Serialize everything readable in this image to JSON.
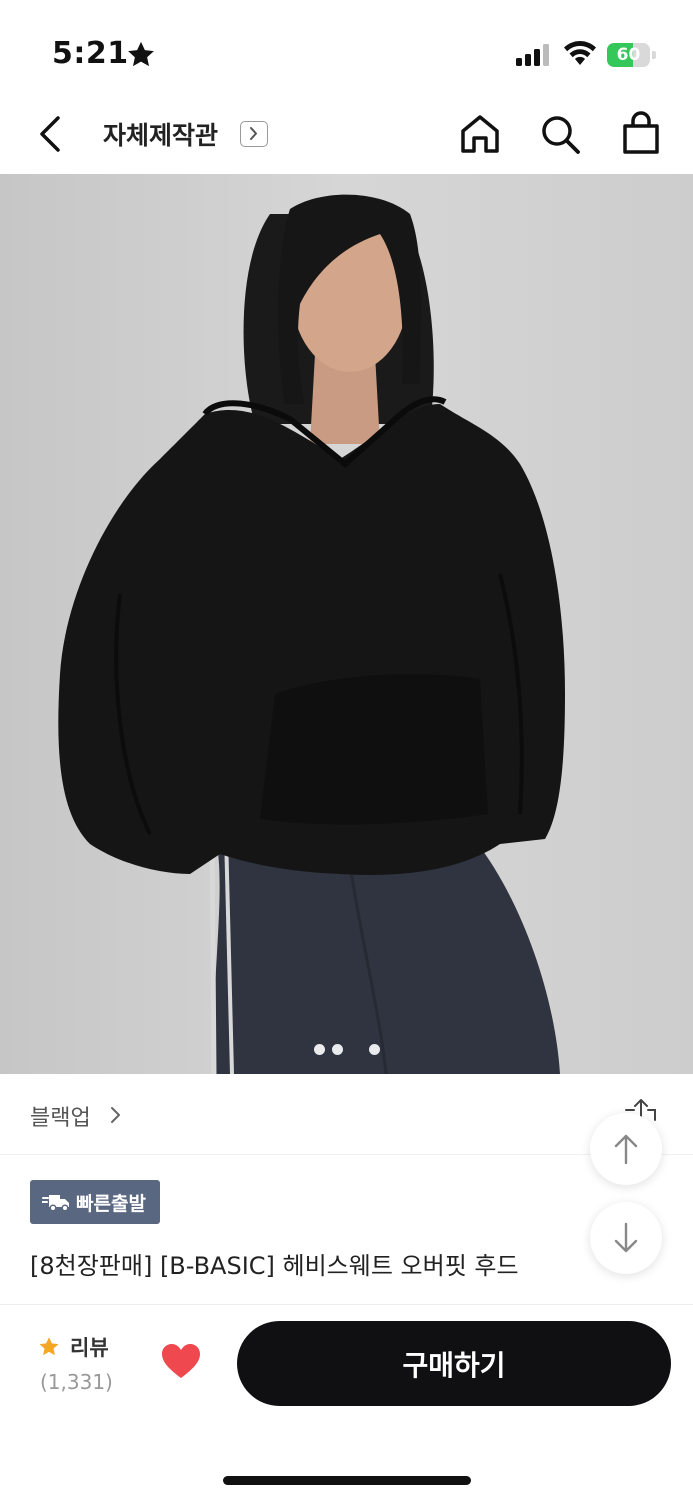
{
  "status_bar": {
    "time": "5:21",
    "battery_level": "60",
    "battery_fraction": 0.6,
    "battery_color": "#34c759"
  },
  "nav": {
    "store_title": "자체제작관",
    "icons": [
      "back-icon",
      "home-icon",
      "search-icon",
      "shopping-bag-icon"
    ]
  },
  "gallery": {
    "page_dots": 3
  },
  "brand": {
    "name": "블랙업"
  },
  "badge": {
    "label": "빠른출발",
    "color": "#5a6780"
  },
  "product": {
    "title": "[8천장판매] [B-BASIC] 헤비스웨트 오버핏 후드"
  },
  "bottom_bar": {
    "review_label": "리뷰",
    "review_count": "(1,331)",
    "buy_label": "구매하기",
    "star_color": "#f5a623",
    "heart_color": "#f0484f"
  }
}
